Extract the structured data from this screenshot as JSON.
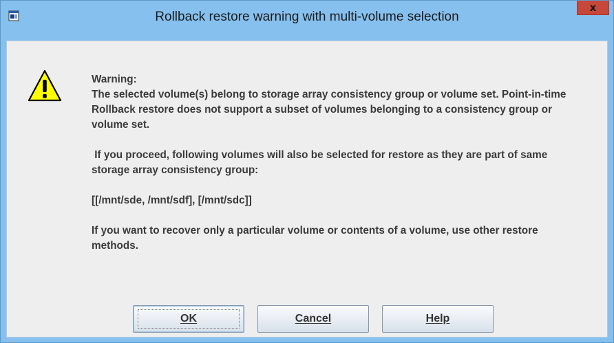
{
  "window": {
    "title": "Rollback restore warning with multi-volume selection",
    "close_glyph": "x"
  },
  "dialog": {
    "icon": "warning-icon",
    "heading": "Warning:",
    "paragraph1": "The selected volume(s) belong to storage array consistency group or volume set. Point-in-time Rollback restore does not support a subset of volumes belonging to a consistency group or volume set.",
    "paragraph2": " If you proceed, following volumes will also be selected for restore as they are part of same storage array consistency group:",
    "volumes": "[[/mnt/sde, /mnt/sdf], [/mnt/sdc]]",
    "paragraph3": "If you want to recover only a particular volume or contents of a volume, use other restore methods."
  },
  "buttons": {
    "ok": "OK",
    "cancel": "Cancel",
    "help": "Help"
  },
  "colors": {
    "title_bar": "#86c0ee",
    "close_button": "#c7473b",
    "client_background": "#eeeeee",
    "warning_yellow": "#ffff00",
    "text": "#3a3a3a"
  }
}
